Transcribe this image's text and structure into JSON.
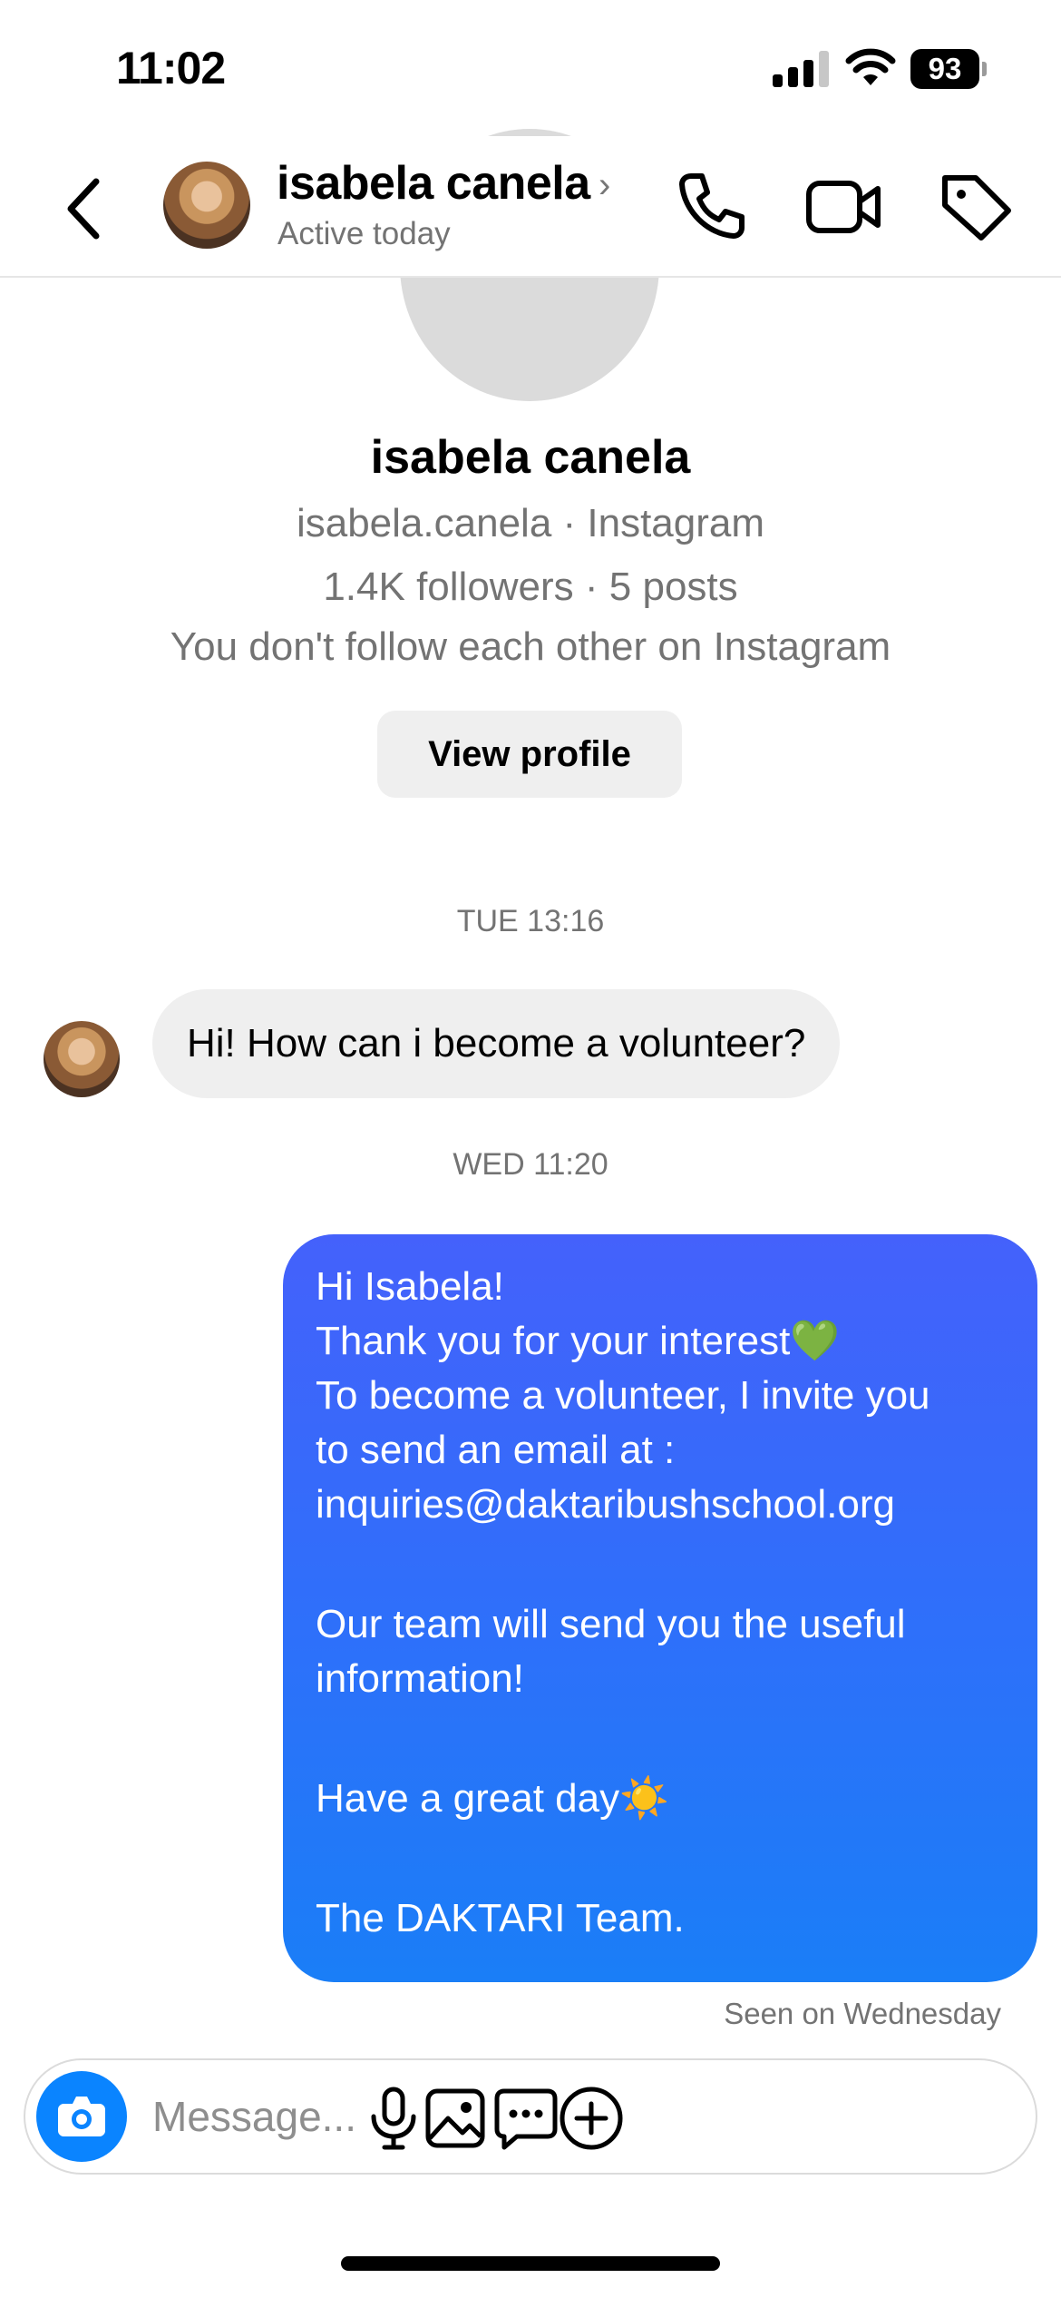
{
  "status_bar": {
    "time": "11:02",
    "battery": "93"
  },
  "header": {
    "name": "isabela canela",
    "chevron": "›",
    "activity": "Active today",
    "icons": [
      "back-icon",
      "phone-icon",
      "video-icon",
      "tag-icon"
    ]
  },
  "profile": {
    "name": "isabela canela",
    "handle": "isabela.canela · Instagram",
    "stats": "1.4K followers · 5 posts",
    "relation": "You don't follow each other on Instagram",
    "view_profile_label": "View profile"
  },
  "messages": {
    "timestamp_1": "TUE 13:16",
    "incoming": "Hi! How can i become a volunteer?",
    "timestamp_2": "WED 11:20",
    "outgoing": {
      "l1": "Hi Isabela!",
      "l2": "Thank you for your interest💚",
      "l3": "To become a volunteer, I invite you",
      "l4": "to send an email at :",
      "l5": "inquiries@daktaribushschool.org",
      "l6": "Our team will send you the useful",
      "l7": "information!",
      "l8": "Have a great day☀️",
      "l9": "The DAKTARI Team."
    },
    "seen": "Seen on Wednesday"
  },
  "composer": {
    "placeholder": "Message...",
    "icons": [
      "camera-icon",
      "microphone-icon",
      "gallery-icon",
      "sticker-icon",
      "plus-icon"
    ],
    "accent": "#0a84ff"
  },
  "colors": {
    "bubble_out_top": "#4461fb",
    "bubble_out_bottom": "#1a7ef7",
    "bubble_in": "#efefef"
  }
}
